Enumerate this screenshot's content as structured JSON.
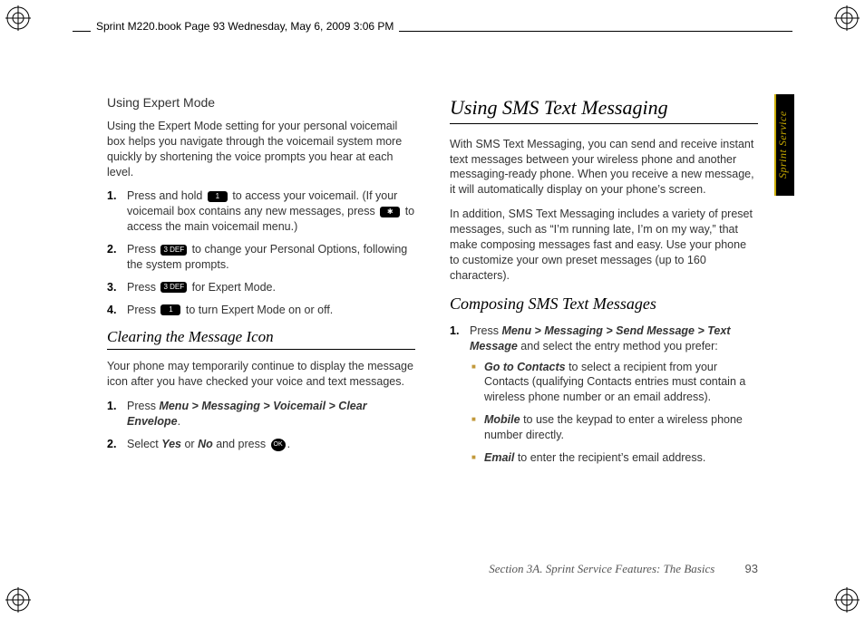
{
  "meta": {
    "header": "Sprint M220.book  Page 93  Wednesday, May 6, 2009  3:06 PM"
  },
  "tab": {
    "label": "Sprint Service"
  },
  "left": {
    "h1": "Using Expert Mode",
    "p1": "Using the Expert Mode setting for your personal voicemail box helps you navigate through the voicemail system more quickly by shortening the voice prompts you hear at each level.",
    "steps": [
      {
        "num": "1.",
        "pre": "Press and hold ",
        "key1": "1",
        "mid": " to access your voicemail. (If your voicemail box contains any new messages, press ",
        "key2": "✱",
        "post": " to access the main voicemail menu.)"
      },
      {
        "num": "2.",
        "pre": "Press ",
        "key1": "3 DEF",
        "post": " to change your Personal Options, following the system prompts."
      },
      {
        "num": "3.",
        "pre": "Press ",
        "key1": "3 DEF",
        "post": " for Expert Mode."
      },
      {
        "num": "4.",
        "pre": "Press ",
        "key1": "1",
        "post": " to turn Expert Mode on or off."
      }
    ],
    "h2": "Clearing the Message Icon",
    "p2": "Your phone may temporarily continue to display the message icon after you have checked your voice and text messages.",
    "steps2": [
      {
        "num": "1.",
        "pre": "Press ",
        "path": "Menu > Messaging > Voicemail > Clear Envelope",
        "post": "."
      },
      {
        "num": "2.",
        "pre": "Select ",
        "term1": "Yes",
        "mid": " or ",
        "term2": "No",
        "post1": " and press ",
        "key": "OK",
        "post2": "."
      }
    ]
  },
  "right": {
    "h1": "Using SMS Text Messaging",
    "p1": "With SMS Text Messaging, you can send and receive instant text messages between your wireless phone and another messaging-ready phone. When you receive a new message, it will automatically display on your phone’s screen.",
    "p2": "In addition, SMS Text Messaging includes a variety of preset messages, such as “I’m running late, I’m on my way,” that make composing messages fast and easy. Use your phone to customize your own preset messages (up to 160 characters).",
    "h2": "Composing SMS Text Messages",
    "step1": {
      "num": "1.",
      "pre": "Press ",
      "path": "Menu > Messaging > Send Message > Text Message",
      "post": " and select the entry method you prefer:"
    },
    "sub": [
      {
        "term": "Go to Contacts",
        "text": " to select a recipient from your Contacts (qualifying Contacts entries must contain a wireless phone number or an email address)."
      },
      {
        "term": "Mobile",
        "text": " to use the keypad to enter a wireless phone number directly."
      },
      {
        "term": "Email",
        "text": " to enter the recipient’s email address."
      }
    ]
  },
  "footer": {
    "section": "Section 3A. Sprint Service Features: The Basics",
    "page": "93"
  }
}
